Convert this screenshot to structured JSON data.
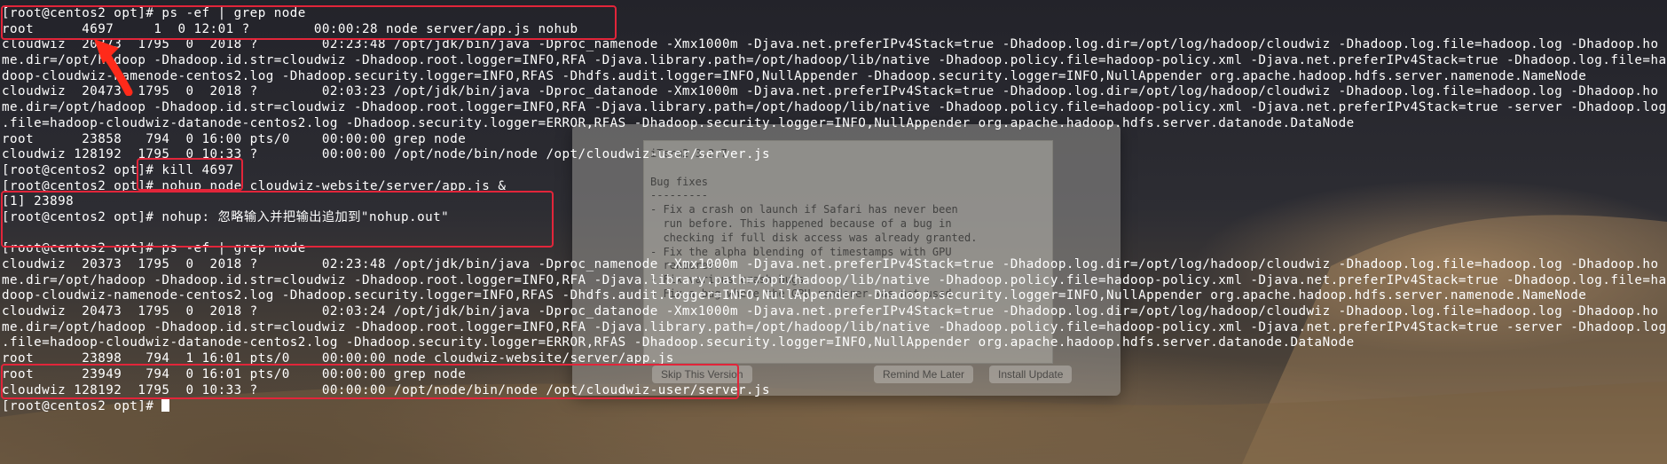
{
  "terminal": {
    "lines": [
      "[root@centos2 opt]# ps -ef | grep node",
      "root      4697     1  0 12:01 ?        00:00:28 node server/app.js nohub",
      "cloudwiz  20373  1795  0  2018 ?        02:23:48 /opt/jdk/bin/java -Dproc_namenode -Xmx1000m -Djava.net.preferIPv4Stack=true -Dhadoop.log.dir=/opt/log/hadoop/cloudwiz -Dhadoop.log.file=hadoop.log -Dhadoop.ho",
      "me.dir=/opt/hadoop -Dhadoop.id.str=cloudwiz -Dhadoop.root.logger=INFO,RFA -Djava.library.path=/opt/hadoop/lib/native -Dhadoop.policy.file=hadoop-policy.xml -Djava.net.preferIPv4Stack=true -Dhadoop.log.file=ha",
      "doop-cloudwiz-namenode-centos2.log -Dhadoop.security.logger=INFO,RFAS -Dhdfs.audit.logger=INFO,NullAppender -Dhadoop.security.logger=INFO,NullAppender org.apache.hadoop.hdfs.server.namenode.NameNode",
      "cloudwiz  20473  1795  0  2018 ?        02:03:23 /opt/jdk/bin/java -Dproc_datanode -Xmx1000m -Djava.net.preferIPv4Stack=true -Dhadoop.log.dir=/opt/log/hadoop/cloudwiz -Dhadoop.log.file=hadoop.log -Dhadoop.ho",
      "me.dir=/opt/hadoop -Dhadoop.id.str=cloudwiz -Dhadoop.root.logger=INFO,RFA -Djava.library.path=/opt/hadoop/lib/native -Dhadoop.policy.file=hadoop-policy.xml -Djava.net.preferIPv4Stack=true -server -Dhadoop.log",
      ".file=hadoop-cloudwiz-datanode-centos2.log -Dhadoop.security.logger=ERROR,RFAS -Dhadoop.security.logger=INFO,NullAppender org.apache.hadoop.hdfs.server.datanode.DataNode",
      "root      23858   794  0 16:00 pts/0    00:00:00 grep node",
      "cloudwiz 128192  1795  0 10:33 ?        00:00:00 /opt/node/bin/node /opt/cloudwiz-user/server.js",
      "[root@centos2 opt]# kill 4697",
      "[root@centos2 opt]# nohup node cloudwiz-website/server/app.js &",
      "[1] 23898",
      "[root@centos2 opt]# nohup: 忽略输入并把输出追加到\"nohup.out\"",
      "",
      "[root@centos2 opt]# ps -ef | grep node",
      "cloudwiz  20373  1795  0  2018 ?        02:23:48 /opt/jdk/bin/java -Dproc_namenode -Xmx1000m -Djava.net.preferIPv4Stack=true -Dhadoop.log.dir=/opt/log/hadoop/cloudwiz -Dhadoop.log.file=hadoop.log -Dhadoop.ho",
      "me.dir=/opt/hadoop -Dhadoop.id.str=cloudwiz -Dhadoop.root.logger=INFO,RFA -Djava.library.path=/opt/hadoop/lib/native -Dhadoop.policy.file=hadoop-policy.xml -Djava.net.preferIPv4Stack=true -Dhadoop.log.file=ha",
      "doop-cloudwiz-namenode-centos2.log -Dhadoop.security.logger=INFO,RFAS -Dhdfs.audit.logger=INFO,NullAppender -Dhadoop.security.logger=INFO,NullAppender org.apache.hadoop.hdfs.server.namenode.NameNode",
      "cloudwiz  20473  1795  0  2018 ?        02:03:24 /opt/jdk/bin/java -Dproc_datanode -Xmx1000m -Djava.net.preferIPv4Stack=true -Dhadoop.log.dir=/opt/log/hadoop/cloudwiz -Dhadoop.log.file=hadoop.log -Dhadoop.ho",
      "me.dir=/opt/hadoop -Dhadoop.id.str=cloudwiz -Dhadoop.root.logger=INFO,RFA -Djava.library.path=/opt/hadoop/lib/native -Dhadoop.policy.file=hadoop-policy.xml -Djava.net.preferIPv4Stack=true -server -Dhadoop.log",
      ".file=hadoop-cloudwiz-datanode-centos2.log -Dhadoop.security.logger=ERROR,RFAS -Dhadoop.security.logger=INFO,NullAppender org.apache.hadoop.hdfs.server.datanode.DataNode",
      "root      23898   794  1 16:01 pts/0    00:00:00 node cloudwiz-website/server/app.js",
      "root      23949   794  0 16:01 pts/0    00:00:00 grep node",
      "cloudwiz 128192  1795  0 10:33 ?        00:00:00 /opt/node/bin/node /opt/cloudwiz-user/server.js",
      "[root@centos2 opt]# "
    ]
  },
  "background_notice": {
    "text": "iTerm2 3.2.7\n\nBug fixes\n---------\n- Fix a crash on launch if Safari has never been\n  run before. This happened because of a bug in\n  checking if full disk access was already granted.\n- Fix the alpha blending of timestamps with GPU\n  renderer.\n- Fix various crash bugs.\n- Fix a bug where the GPU renderer was not used",
    "buttons": [
      "Skip This Version",
      "Remind Me Later",
      "Install Update"
    ]
  },
  "colors": {
    "highlight": "#e2253a",
    "text": "#ffffff"
  }
}
